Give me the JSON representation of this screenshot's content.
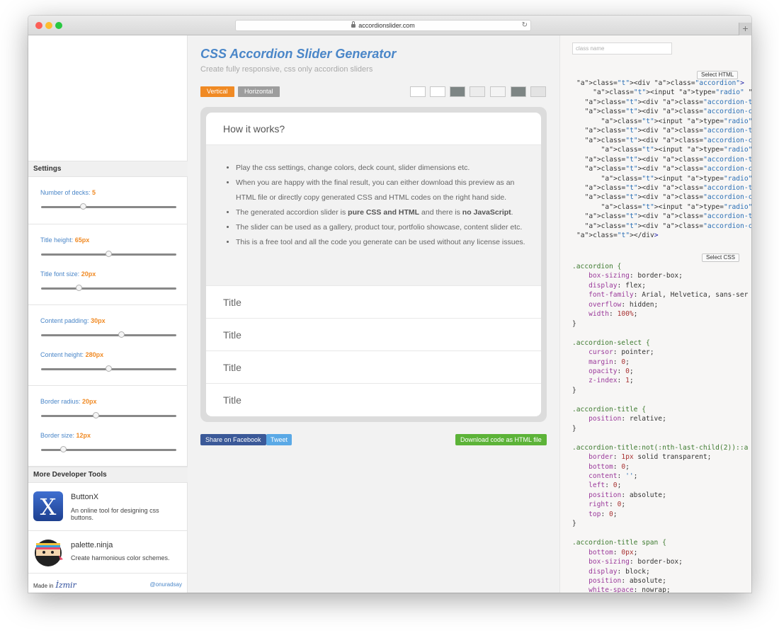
{
  "browser": {
    "url": "accordionslider.com"
  },
  "sidebar": {
    "settings_heading": "Settings",
    "settings": [
      {
        "label": "Number of decks:",
        "value": "5",
        "level": 0.3
      },
      {
        "label": "Title height:",
        "value": "65px",
        "level": 0.5
      },
      {
        "label": "Title font size:",
        "value": "20px",
        "level": 0.27
      },
      {
        "label": "Content padding:",
        "value": "30px",
        "level": 0.6
      },
      {
        "label": "Content height:",
        "value": "280px",
        "level": 0.5
      },
      {
        "label": "Border radius:",
        "value": "20px",
        "level": 0.4
      },
      {
        "label": "Border size:",
        "value": "12px",
        "level": 0.15
      }
    ],
    "tools_heading": "More Developer Tools",
    "tools": [
      {
        "name": "ButtonX",
        "desc": "An online tool for designing css buttons.",
        "icon": "buttonx-logo-icon"
      },
      {
        "name": "palette.ninja",
        "desc": "Create harmonious color schemes.",
        "icon": "ninja-logo-icon"
      }
    ],
    "made_in": "Made in",
    "made_in_logo": "İzmir",
    "handle": "@onuradsay"
  },
  "main": {
    "title": "CSS Accordion Slider Generator",
    "subtitle": "Create fully responsive, css only accordion sliders",
    "orientation": {
      "vertical": "Vertical",
      "horizontal": "Horizontal",
      "active": "vertical"
    },
    "swatches": [
      "#ffffff",
      "#ffffff",
      "#7d8584",
      "#ececec",
      "#f4f4f4",
      "#7d8584",
      "#e3e3e3"
    ],
    "accordion": {
      "open_title": "How it works?",
      "items": [
        {
          "parts": [
            {
              "text": "Play the css settings, change colors, deck count, slider dimensions etc."
            }
          ]
        },
        {
          "parts": [
            {
              "text": "When you are happy with the final result, you can either download this preview as an HTML file or directly copy generated CSS and HTML codes on the right hand side."
            }
          ]
        },
        {
          "parts": [
            {
              "text": "The generated accordion slider is "
            },
            {
              "text": "pure CSS and HTML",
              "bold": true
            },
            {
              "text": " and there is "
            },
            {
              "text": "no JavaScript",
              "bold": true
            },
            {
              "text": "."
            }
          ]
        },
        {
          "parts": [
            {
              "text": "The slider can be used as a gallery, product tour, portfolio showcase, content slider etc."
            }
          ]
        },
        {
          "parts": [
            {
              "text": "This is a free tool and all the code you generate can be used without any license issues."
            }
          ]
        }
      ],
      "titles": [
        "Title",
        "Title",
        "Title",
        "Title"
      ]
    },
    "share_facebook": "Share on Facebook",
    "tweet": "Tweet",
    "download": "Download code as HTML file",
    "colors": {
      "accent": "#4a86c8",
      "orange": "#f08a24",
      "facebook": "#3b5998",
      "tweet": "#5aa9e6",
      "download": "#5cb338"
    }
  },
  "code": {
    "class_placeholder": "class name",
    "select_html": "Select HTML",
    "select_css": "Select CSS",
    "html_lines": [
      "<div class=\"accordion\">",
      "    <input type=\"radio\" name=\"select\" clas",
      "  <div class=\"accordion-title\"><span>Titl",
      "  <div class=\"accordion-content\">Content<",
      "      <input type=\"radio\" name=\"select\"",
      "  <div class=\"accordion-title\"><span>Titl",
      "  <div class=\"accordion-content\">Content<",
      "      <input type=\"radio\" name=\"select\"",
      "  <div class=\"accordion-title\"><span>Titl",
      "  <div class=\"accordion-content\">Content<",
      "      <input type=\"radio\" name=\"select\"",
      "  <div class=\"accordion-title\"><span>Titl",
      "  <div class=\"accordion-content\">Content<",
      "      <input type=\"radio\" name=\"select\"",
      "  <div class=\"accordion-title\"><span>Titl",
      "  <div class=\"accordion-content\">Content<",
      "</div>"
    ],
    "css_lines": [
      ".accordion {",
      "    box-sizing: border-box;",
      "    display: flex;",
      "    font-family: Arial, Helvetica, sans-ser",
      "    overflow: hidden;",
      "    width: 100%;",
      "}",
      "",
      ".accordion-select {",
      "    cursor: pointer;",
      "    margin: 0;",
      "    opacity: 0;",
      "    z-index: 1;",
      "}",
      "",
      ".accordion-title {",
      "    position: relative;",
      "}",
      "",
      ".accordion-title:not(:nth-last-child(2))::a",
      "    border: 1px solid transparent;",
      "    bottom: 0;",
      "    content: '';",
      "    left: 0;",
      "    position: absolute;",
      "    right: 0;",
      "    top: 0;",
      "}",
      "",
      ".accordion-title span {",
      "    bottom: 0px;",
      "    box-sizing: border-box;",
      "    display: block;",
      "    position: absolute;",
      "    white-space: nowrap;"
    ]
  }
}
